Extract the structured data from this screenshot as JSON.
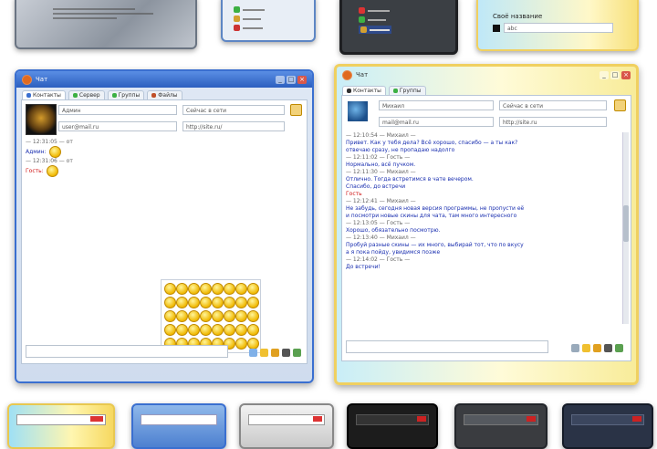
{
  "top_thumbnails": [
    {
      "id": "metal",
      "label": "metal-skin-thumb"
    },
    {
      "id": "light-list",
      "label": "light-list-thumb"
    },
    {
      "id": "dark-list",
      "label": "dark-list-thumb"
    },
    {
      "id": "aurora-list",
      "label": "aurora-list-thumb"
    }
  ],
  "aurora_partial": {
    "label_text": "Своё название",
    "field_text": "abc"
  },
  "window_left": {
    "title": "Чат",
    "tabs": [
      "Контакты",
      "Сервер",
      "Группы",
      "Файлы"
    ],
    "fields": {
      "name": "Админ",
      "status": "Сейчас в сети",
      "email": "user@mail.ru",
      "site": "http://site.ru/"
    },
    "messages": [
      {
        "kind": "gray",
        "text": "— 12:31:05 — от"
      },
      {
        "kind": "blue",
        "text": "Админ:"
      },
      {
        "kind": "gray",
        "text": "— 12:31:06 — от"
      },
      {
        "kind": "red",
        "text": "Гость:"
      }
    ],
    "emoji_count": 40
  },
  "window_right": {
    "title": "Чат",
    "tabs": [
      "Контакты",
      "Группы"
    ],
    "fields": {
      "name": "Михаил",
      "status": "Сейчас в сети",
      "email": "mail@mail.ru",
      "site": "http://site.ru"
    },
    "messages": [
      {
        "kind": "gray",
        "text": "— 12:10:54 — Михаил —"
      },
      {
        "kind": "blue",
        "text": "Привет. Как у тебя дела? Всё хорошо, спасибо — а ты как?"
      },
      {
        "kind": "blue",
        "text": "отвечаю сразу, не пропадаю надолго"
      },
      {
        "kind": "gray",
        "text": "— 12:11:02 — Гость —"
      },
      {
        "kind": "blue",
        "text": "Нормально, всё пучком."
      },
      {
        "kind": "gray",
        "text": "— 12:11:30 — Михаил —"
      },
      {
        "kind": "blue",
        "text": "Отлично. Тогда встретимся в чате вечером."
      },
      {
        "kind": "blue",
        "text": "Спасибо, до встречи"
      },
      {
        "kind": "red",
        "text": "Гость"
      },
      {
        "kind": "gray",
        "text": "— 12:12:41 — Михаил —"
      },
      {
        "kind": "blue",
        "text": "Не забудь, сегодня новая версия программы, не пропусти её"
      },
      {
        "kind": "blue",
        "text": "и посмотри новые скины для чата, там много интересного"
      },
      {
        "kind": "gray",
        "text": "— 12:13:05 — Гость —"
      },
      {
        "kind": "blue",
        "text": "Хорошо, обязательно посмотрю."
      },
      {
        "kind": "gray",
        "text": "— 12:13:40 — Михаил —"
      },
      {
        "kind": "blue",
        "text": "Пробуй разные скины — их много, выбирай тот, что по вкусу"
      },
      {
        "kind": "blue",
        "text": "а я пока пойду, увидимся позже"
      },
      {
        "kind": "gray",
        "text": "— 12:14:02 — Гость —"
      },
      {
        "kind": "blue",
        "text": "До встречи!"
      }
    ]
  },
  "bottom_thumbnails": [
    {
      "id": "rainbow"
    },
    {
      "id": "blue"
    },
    {
      "id": "silver"
    },
    {
      "id": "black-red"
    },
    {
      "id": "graphite"
    },
    {
      "id": "navy"
    }
  ],
  "colors": {
    "xp_blue": "#3a6fd0",
    "aurora_border": "#f0d060",
    "dark_bg": "#2b2b2b"
  }
}
